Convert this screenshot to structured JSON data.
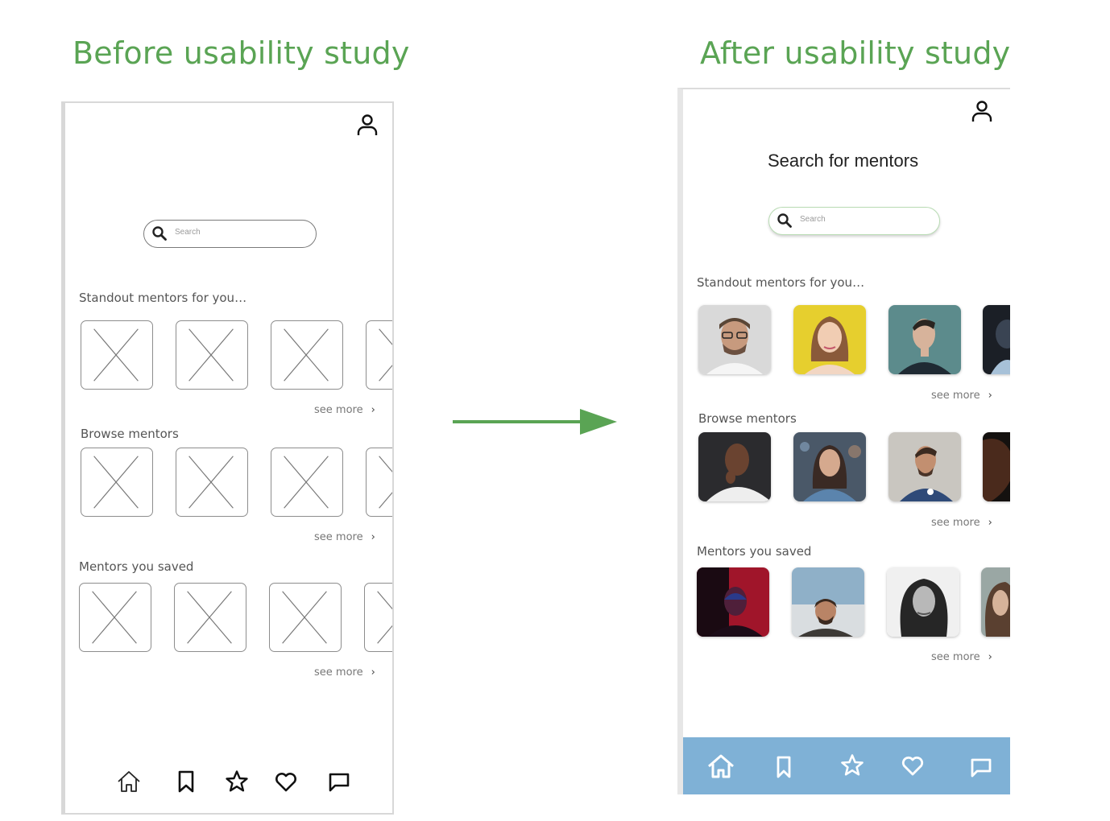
{
  "headings": {
    "before": "Before usability study",
    "after": "After usability study"
  },
  "colors": {
    "heading_green": "#5aa454",
    "arrow_green": "#5aa454",
    "after_navbar_blue": "#7fb1d6",
    "wireframe_gray": "#8d8d8d"
  },
  "before": {
    "search_placeholder": "Search",
    "sections": [
      {
        "label": "Standout mentors for you…",
        "see_more": "see more"
      },
      {
        "label": "Browse mentors",
        "see_more": "see more"
      },
      {
        "label": "Mentors you saved",
        "see_more": "see more"
      }
    ],
    "icons": [
      "profile-icon",
      "search-icon",
      "image-placeholder-icon",
      "chevron-right-icon"
    ],
    "nav": [
      "home-icon",
      "bookmark-icon",
      "star-icon",
      "heart-icon",
      "message-icon"
    ]
  },
  "after": {
    "title": "Search for mentors",
    "search_placeholder": "Search",
    "sections": [
      {
        "label": "Standout mentors for you…",
        "see_more": "see more"
      },
      {
        "label": "Browse mentors",
        "see_more": "see more"
      },
      {
        "label": "Mentors you saved",
        "see_more": "see more"
      }
    ],
    "icons": [
      "profile-icon",
      "search-icon",
      "mentor-photo",
      "chevron-right-icon"
    ],
    "nav": [
      "home-icon",
      "bookmark-icon",
      "star-icon",
      "heart-icon",
      "message-icon"
    ]
  },
  "chevron": "›"
}
